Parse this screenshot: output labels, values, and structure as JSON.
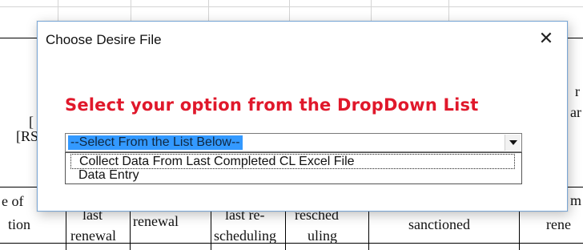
{
  "background": {
    "left_labels": [
      "[",
      "[RS"
    ],
    "right_labels": [
      "r",
      "ar"
    ],
    "header_row": [
      {
        "lines": [
          "e of",
          "tion"
        ]
      },
      {
        "lines": [
          "last",
          "renewal"
        ]
      },
      {
        "lines": [
          "renewal"
        ]
      },
      {
        "lines": [
          "last re-",
          "scheduling"
        ]
      },
      {
        "lines": [
          "resched",
          "uling"
        ]
      },
      {
        "lines": [
          "sanctioned"
        ]
      },
      {
        "lines": [
          "m",
          "rene"
        ]
      }
    ]
  },
  "dialog": {
    "title": "Choose Desire File",
    "close_glyph": "✕",
    "prompt": "Select your option from the DropDown List",
    "combo": {
      "selected": "--Select From the List Below--"
    },
    "options": [
      "Collect Data From Last Completed CL Excel File",
      "Data Entry"
    ],
    "colors": {
      "prompt": "#e0182b",
      "selection": "#3399ff",
      "border": "#7aa7d6"
    }
  }
}
